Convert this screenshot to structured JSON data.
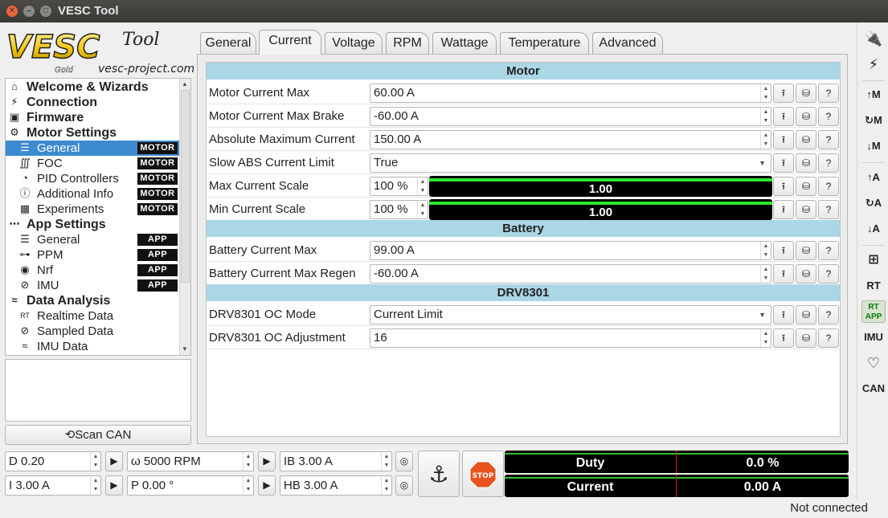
{
  "window": {
    "title": "VESC Tool"
  },
  "logo": {
    "main": "VESC",
    "tool": "Tool",
    "gold": "Gold",
    "url": "vesc-project.com"
  },
  "tree": [
    {
      "label": "Welcome & Wizards",
      "level": 0,
      "icon": "home-icon"
    },
    {
      "label": "Connection",
      "level": 0,
      "icon": "plug-icon"
    },
    {
      "label": "Firmware",
      "level": 0,
      "icon": "chip-icon"
    },
    {
      "label": "Motor Settings",
      "level": 0,
      "icon": "motor-icon"
    },
    {
      "label": "General",
      "level": 1,
      "icon": "sliders-icon",
      "badge": "MOTOR",
      "selected": true
    },
    {
      "label": "FOC",
      "level": 1,
      "icon": "coil-icon",
      "badge": "MOTOR"
    },
    {
      "label": "PID Controllers",
      "level": 1,
      "icon": "gauge-icon",
      "badge": "MOTOR"
    },
    {
      "label": "Additional Info",
      "level": 1,
      "icon": "info-icon",
      "badge": "MOTOR"
    },
    {
      "label": "Experiments",
      "level": 1,
      "icon": "calculator-icon",
      "badge": "MOTOR"
    },
    {
      "label": "App Settings",
      "level": 0,
      "icon": "app-icon"
    },
    {
      "label": "General",
      "level": 1,
      "icon": "sliders-icon",
      "badge": "APP"
    },
    {
      "label": "PPM",
      "level": 1,
      "icon": "gamepad-icon",
      "badge": "APP"
    },
    {
      "label": "Nrf",
      "level": 1,
      "icon": "wireless-icon",
      "badge": "APP"
    },
    {
      "label": "IMU",
      "level": 1,
      "icon": "imu-icon",
      "badge": "APP"
    },
    {
      "label": "Data Analysis",
      "level": 0,
      "icon": "chart-icon"
    },
    {
      "label": "Realtime Data",
      "level": 1,
      "icon": "realtime-icon"
    },
    {
      "label": "Sampled Data",
      "level": 1,
      "icon": "sampled-icon"
    },
    {
      "label": "IMU Data",
      "level": 1,
      "icon": "imu-data-icon"
    }
  ],
  "scan_can": {
    "label": "Scan CAN",
    "icon": "refresh-icon"
  },
  "tabs": [
    {
      "label": "General",
      "active": false
    },
    {
      "label": "Current",
      "active": true
    },
    {
      "label": "Voltage",
      "active": false
    },
    {
      "label": "RPM",
      "active": false
    },
    {
      "label": "Wattage",
      "active": false
    },
    {
      "label": "Temperature",
      "active": false
    },
    {
      "label": "Advanced",
      "active": false
    }
  ],
  "sections": {
    "motor": "Motor",
    "battery": "Battery",
    "drv": "DRV8301"
  },
  "params": {
    "motor_current_max": {
      "name": "Motor Current Max",
      "value": "60.00 A"
    },
    "motor_current_max_brake": {
      "name": "Motor Current Max Brake",
      "value": "-60.00 A"
    },
    "absolute_max_current": {
      "name": "Absolute Maximum Current",
      "value": "150.00 A"
    },
    "slow_abs_current_limit": {
      "name": "Slow ABS Current Limit",
      "value": "True"
    },
    "max_current_scale": {
      "name": "Max Current Scale",
      "value": "100 %",
      "bar_text": "1.00",
      "level": 1.0
    },
    "min_current_scale": {
      "name": "Min Current Scale",
      "value": "100 %",
      "bar_text": "1.00",
      "level": 1.0
    },
    "battery_current_max": {
      "name": "Battery Current Max",
      "value": "99.00 A"
    },
    "battery_current_max_regen": {
      "name": "Battery Current Max Regen",
      "value": "-60.00 A"
    },
    "drv_oc_mode": {
      "name": "DRV8301 OC Mode",
      "value": "Current Limit"
    },
    "drv_oc_adjustment": {
      "name": "DRV8301 OC Adjustment",
      "value": "16"
    }
  },
  "right_toolbar": [
    "connect-icon",
    "disconnect-icon",
    "read-motor-config-icon",
    "read-default-motor-config-icon",
    "write-motor-config-icon",
    "read-app-config-icon",
    "read-default-app-config-icon",
    "write-app-config-icon",
    "can-fwd-icon",
    "rt-data-icon",
    "rt-app-icon",
    "imu-icon",
    "heart-icon",
    "can-icon"
  ],
  "right_toolbar_text": {
    "read_m": "↑M",
    "def_m": "↻M",
    "write_m": "↓M",
    "read_a": "↑A",
    "def_a": "↻A",
    "write_a": "↓A",
    "rt": "RT",
    "rt_app_1": "RT",
    "rt_app_2": "APP",
    "imu": "IMU",
    "can": "CAN"
  },
  "bottom": {
    "duty": "D 0.20",
    "current": "I 3.00 A",
    "rpm": "ω 5000 RPM",
    "position": "P 0.00 °",
    "ib": "IB 3.00 A",
    "hb": "HB 3.00 A",
    "stop": "STOP"
  },
  "meters": {
    "duty": {
      "label": "Duty",
      "value": "0.0 %"
    },
    "current": {
      "label": "Current",
      "value": "0.00 A"
    }
  },
  "status": "Not connected",
  "colors": {
    "section_header": "#abd6e6",
    "selection": "#3d8ad0",
    "bar_fill": "#2ee82e",
    "stop": "#e8521c"
  }
}
